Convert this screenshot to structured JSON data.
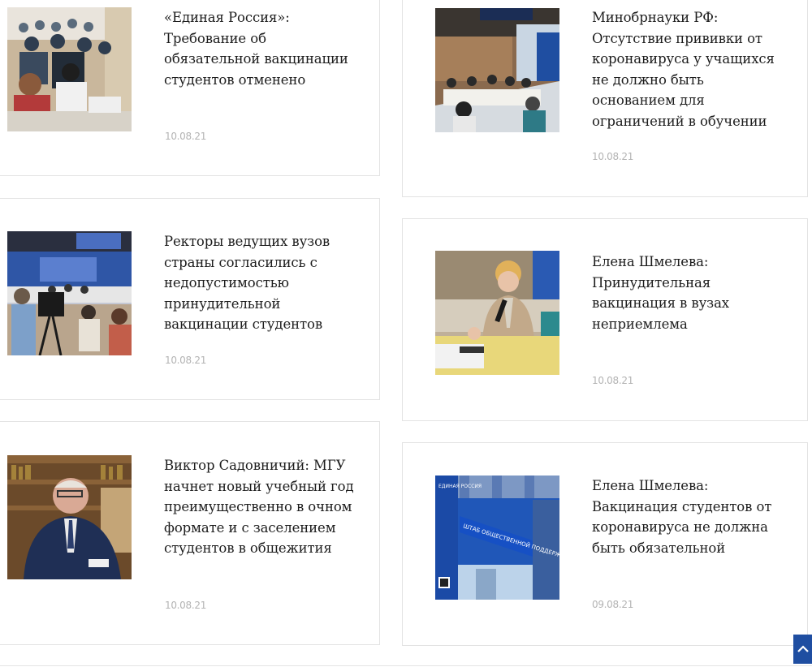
{
  "news": [
    {
      "title": "«Единая Россия»: Требование об обязательной вакцинации студентов отменено",
      "date": "10.08.21",
      "image": "lecture-hall-photo"
    },
    {
      "title": "Минобрнауки РФ: Отсутствие прививки от коронавируса у учащихся не должно быть основанием для ограничений в обучении",
      "date": "10.08.21",
      "image": "conference-room-photo"
    },
    {
      "title": "Ректоры ведущих вузов страны согласились с недопустимостью принудительной вакцинации студентов",
      "date": "10.08.21",
      "image": "press-conference-photo"
    },
    {
      "title": "Елена Шмелева: Принудительная вакцинация в вузах неприемлема",
      "date": "10.08.21",
      "image": "woman-speaker-photo"
    },
    {
      "title": "Виктор Садовничий: МГУ начнет новый учебный год преимущественно в очном формате и с заселением студентов в общежития",
      "date": "10.08.21",
      "image": "rector-portrait-photo"
    },
    {
      "title": "Елена Шмелева: Вакцинация студентов от коронавируса не должна быть обязательной",
      "date": "09.08.21",
      "image": "support-headquarters-photo"
    }
  ],
  "signage": {
    "party_logo_text": "ЕДИНАЯ РОССИЯ",
    "banner_text": "ШТАБ ОБЩЕСТВЕННОЙ ПОДДЕРЖКИ"
  },
  "colors": {
    "accent": "#1f4ea1",
    "date": "#b3b3b3",
    "border": "#e3e3e3"
  },
  "scroll_top_icon": "chevron-up-icon"
}
